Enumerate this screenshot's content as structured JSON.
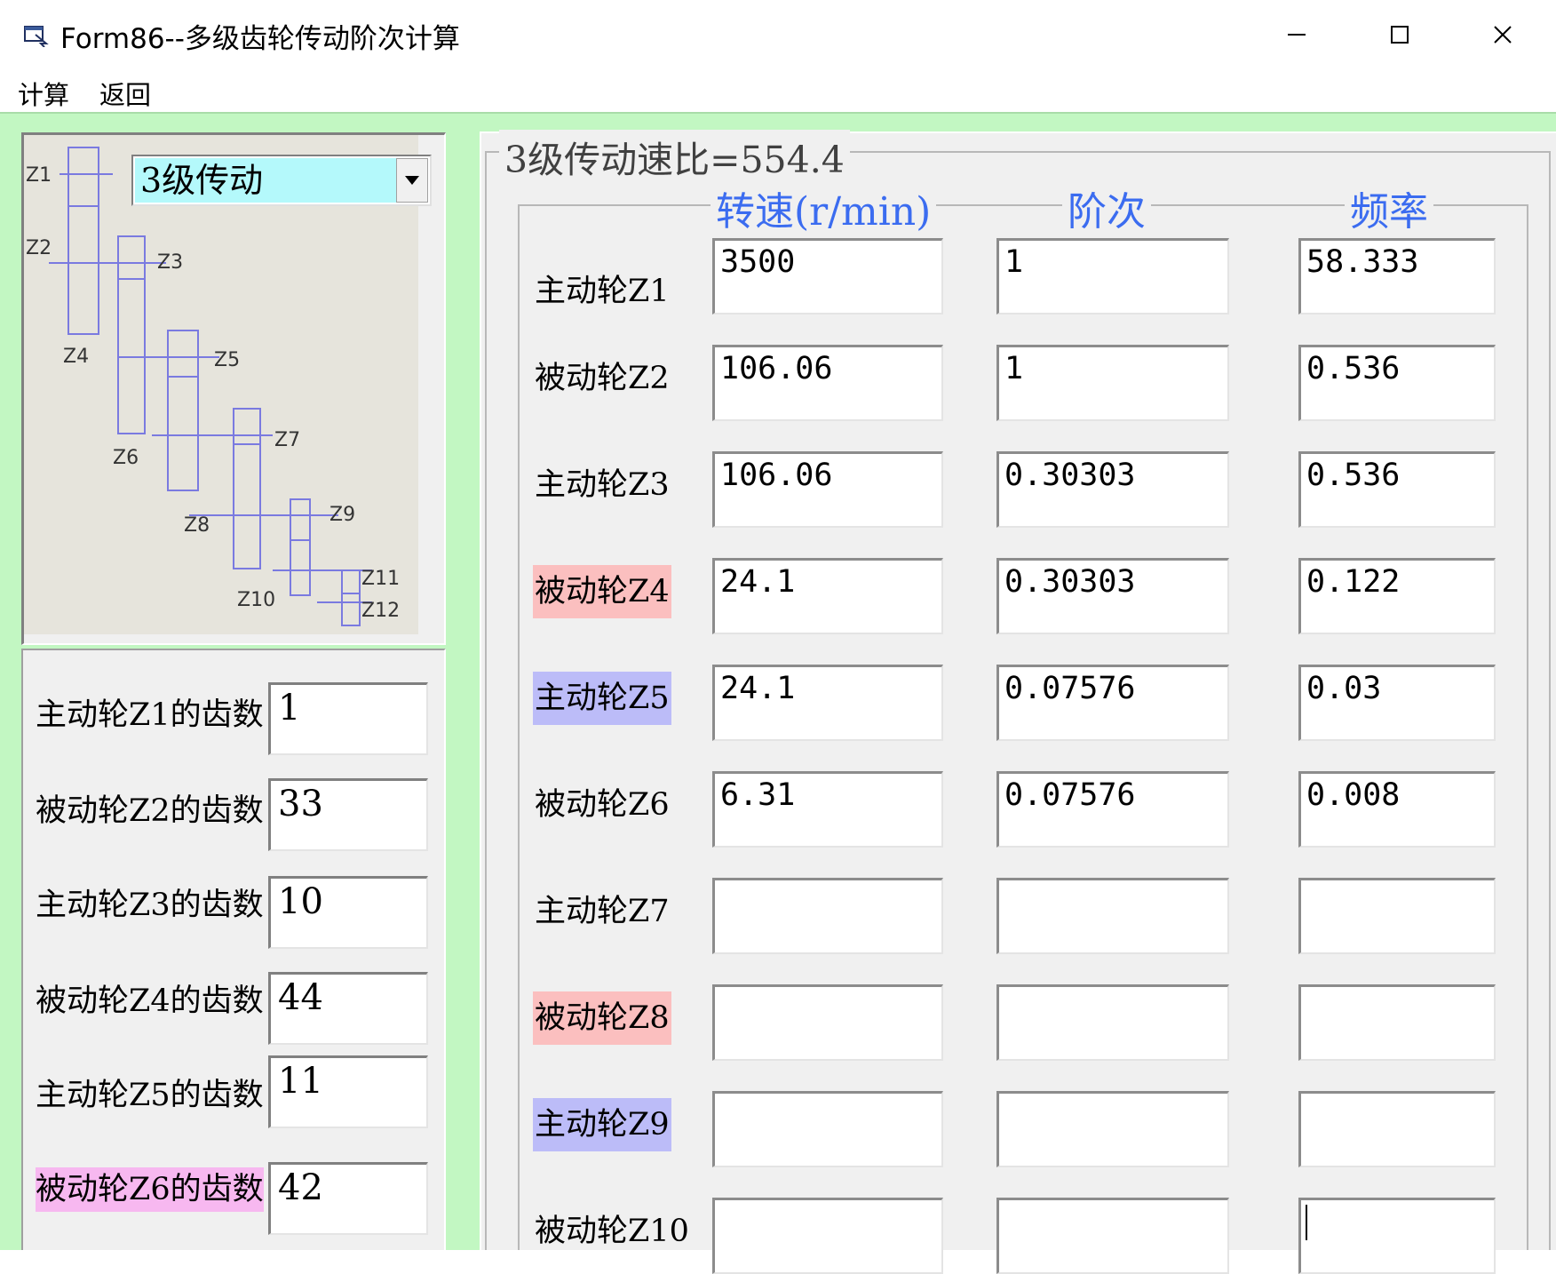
{
  "window": {
    "title": "Form86--多级齿轮传动阶次计算",
    "controls": [
      "minimize",
      "maximize",
      "close"
    ]
  },
  "menu": {
    "items": [
      {
        "label": "计算"
      },
      {
        "label": "返回"
      }
    ]
  },
  "diagram": {
    "stage_select": {
      "value": "3级传动"
    },
    "gear_labels": [
      "Z1",
      "Z2",
      "Z3",
      "Z4",
      "Z5",
      "Z6",
      "Z7",
      "Z8",
      "Z9",
      "Z10",
      "Z11",
      "Z12"
    ]
  },
  "teeth": {
    "rows": [
      {
        "label": "主动轮Z1的齿数",
        "value": "1"
      },
      {
        "label": "被动轮Z2的齿数",
        "value": "33"
      },
      {
        "label": "主动轮Z3的齿数",
        "value": "10"
      },
      {
        "label": "被动轮Z4的齿数",
        "value": "44"
      },
      {
        "label": "主动轮Z5的齿数",
        "value": "11"
      },
      {
        "label": "被动轮Z6的齿数",
        "value": "42",
        "highlight": "#f7b8f0"
      }
    ]
  },
  "results": {
    "ratio_title": "3级传动速比=554.4",
    "headers": {
      "speed": "转速(r/min)",
      "order": "阶次",
      "freq": "频率"
    },
    "header_color": "#3b6cf0",
    "rows": [
      {
        "label": "主动轮Z1",
        "speed": "3500",
        "order": "1",
        "freq": "58.333",
        "highlight": ""
      },
      {
        "label": "被动轮Z2",
        "speed": "106.06",
        "order": "1",
        "freq": "0.536",
        "highlight": ""
      },
      {
        "label": "主动轮Z3",
        "speed": "106.06",
        "order": "0.30303",
        "freq": "0.536",
        "highlight": ""
      },
      {
        "label": "被动轮Z4",
        "speed": "24.1",
        "order": "0.30303",
        "freq": "0.122",
        "highlight": "#fbbfbf"
      },
      {
        "label": "主动轮Z5",
        "speed": "24.1",
        "order": "0.07576",
        "freq": "0.03",
        "highlight": "#bcbcf8"
      },
      {
        "label": "被动轮Z6",
        "speed": "6.31",
        "order": "0.07576",
        "freq": "0.008",
        "highlight": ""
      },
      {
        "label": "主动轮Z7",
        "speed": "",
        "order": "",
        "freq": "",
        "highlight": ""
      },
      {
        "label": "被动轮Z8",
        "speed": "",
        "order": "",
        "freq": "",
        "highlight": "#fbbfbf"
      },
      {
        "label": "主动轮Z9",
        "speed": "",
        "order": "",
        "freq": "",
        "highlight": "#bcbcf8"
      },
      {
        "label": "被动轮Z10",
        "speed": "",
        "order": "",
        "freq": "",
        "highlight": ""
      }
    ]
  }
}
